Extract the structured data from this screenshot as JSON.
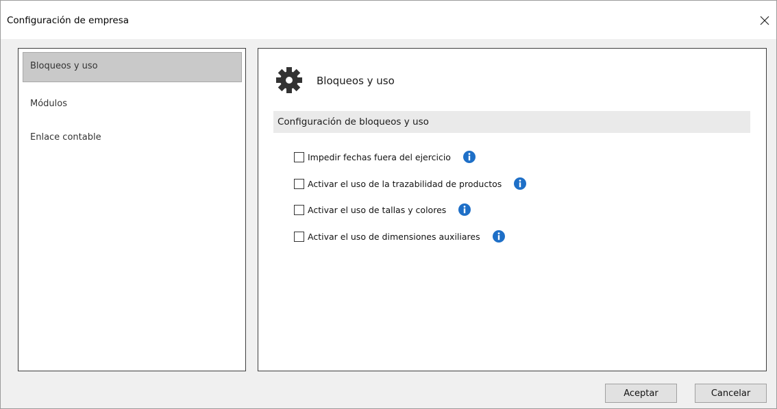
{
  "window": {
    "title": "Configuración de empresa",
    "close_icon": "close-icon"
  },
  "sidebar": {
    "items": [
      {
        "label": "Bloqueos y uso",
        "selected": true
      },
      {
        "label": "Módulos",
        "selected": false
      },
      {
        "label": "Enlace contable",
        "selected": false
      }
    ]
  },
  "main": {
    "icon": "gear-icon",
    "title": "Bloqueos y uso",
    "section_title": "Configuración de bloqueos y uso",
    "options": [
      {
        "label": "Impedir fechas fuera del ejercicio",
        "checked": false,
        "icon": "info-icon"
      },
      {
        "label": "Activar el uso de la trazabilidad de productos",
        "checked": false,
        "icon": "info-icon"
      },
      {
        "label": "Activar el uso de tallas y colores",
        "checked": false,
        "icon": "info-icon"
      },
      {
        "label": "Activar el uso de dimensiones auxiliares",
        "checked": false,
        "icon": "info-icon"
      }
    ]
  },
  "footer": {
    "accept_label": "Aceptar",
    "cancel_label": "Cancelar"
  },
  "colors": {
    "info_blue": "#1e6fc7",
    "selected_bg": "#c9c9c9",
    "section_bg": "#eaeaea"
  }
}
